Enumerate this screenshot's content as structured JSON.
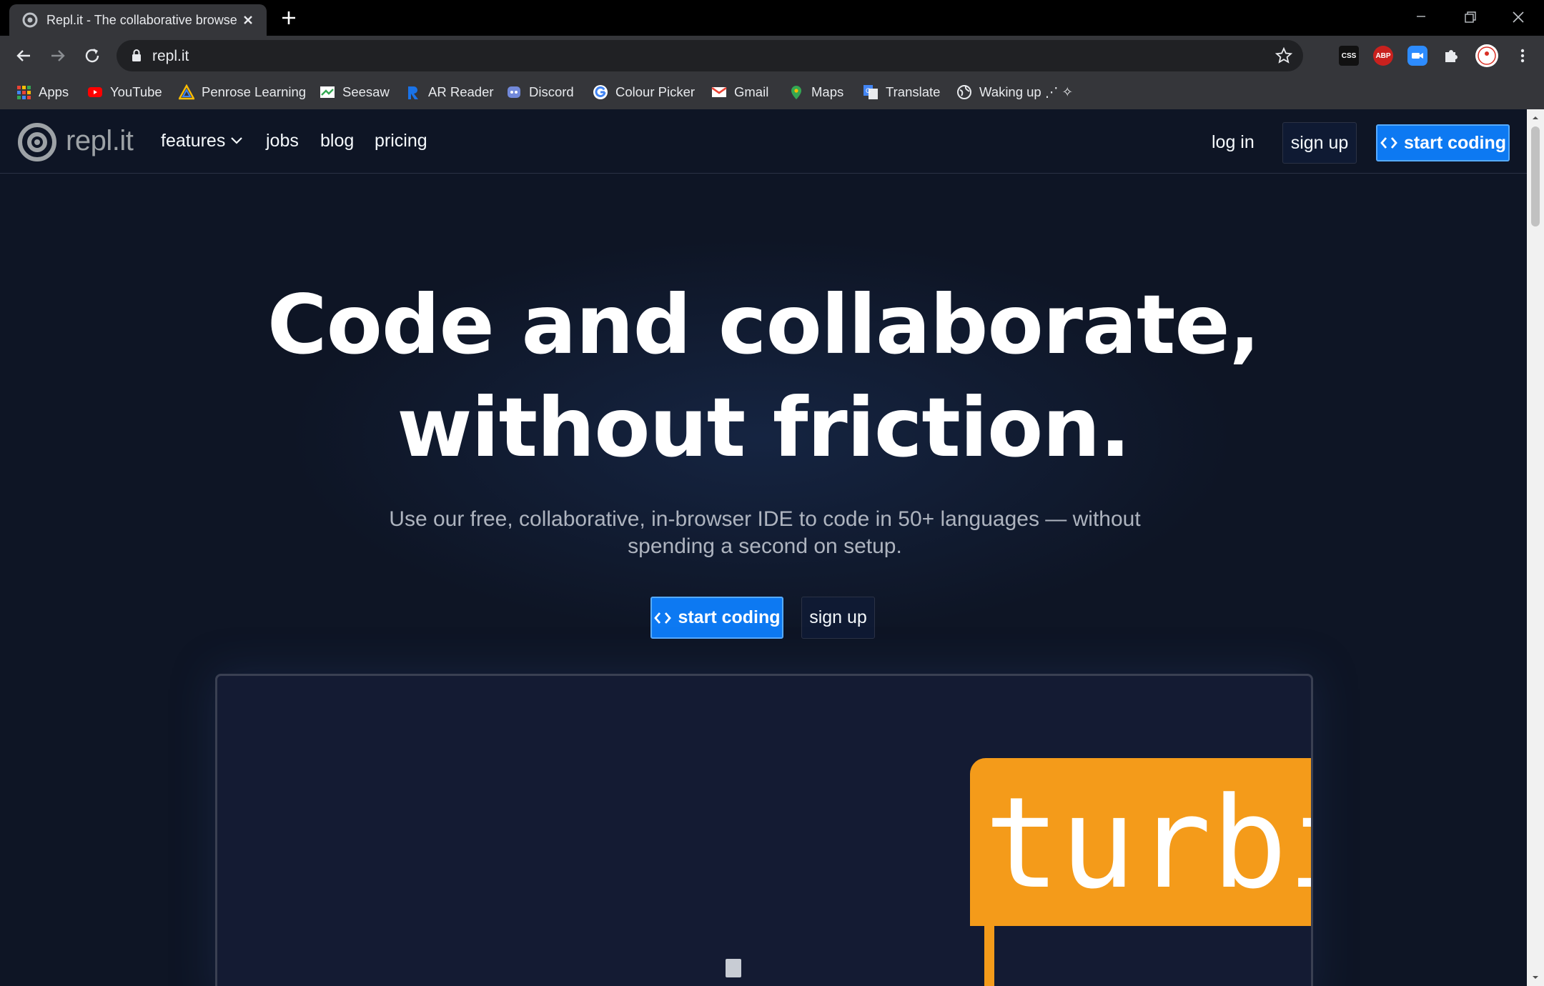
{
  "browser": {
    "tab_title": "Repl.it - The collaborative browse",
    "url": "repl.it",
    "bookmarks": [
      {
        "label": "Apps",
        "icon": "apps-grid-icon"
      },
      {
        "label": "YouTube",
        "icon": "youtube-icon"
      },
      {
        "label": "Penrose Learning",
        "icon": "penrose-icon"
      },
      {
        "label": "Seesaw",
        "icon": "seesaw-icon"
      },
      {
        "label": "AR Reader",
        "icon": "ar-reader-icon"
      },
      {
        "label": "Discord",
        "icon": "discord-icon"
      },
      {
        "label": "Colour Picker",
        "icon": "google-icon"
      },
      {
        "label": "Gmail",
        "icon": "gmail-icon"
      },
      {
        "label": "Maps",
        "icon": "maps-icon"
      },
      {
        "label": "Translate",
        "icon": "translate-icon"
      },
      {
        "label": "Waking up ⋰ ✧",
        "icon": "globe-icon"
      }
    ],
    "extensions": [
      "CSS",
      "ABP",
      "zoom",
      "extensions",
      "profile"
    ]
  },
  "site": {
    "logo_text": "repl.it",
    "nav": {
      "features": "features",
      "jobs": "jobs",
      "blog": "blog",
      "pricing": "pricing",
      "login": "log in",
      "signup": "sign up",
      "start": "start coding"
    },
    "hero": {
      "line1": "Code and collaborate,",
      "line2": "without friction.",
      "subtitle": "Use our free, collaborative, in-browser IDE to code in 50+ languages — without spending a second on setup.",
      "start_button": "start coding",
      "signup_button": "sign up"
    },
    "preview": {
      "banner_text": "turbi"
    }
  },
  "colors": {
    "background": "#0e1525",
    "accent_blue": "#0d79f2",
    "turbo_orange": "#f49b1a"
  }
}
